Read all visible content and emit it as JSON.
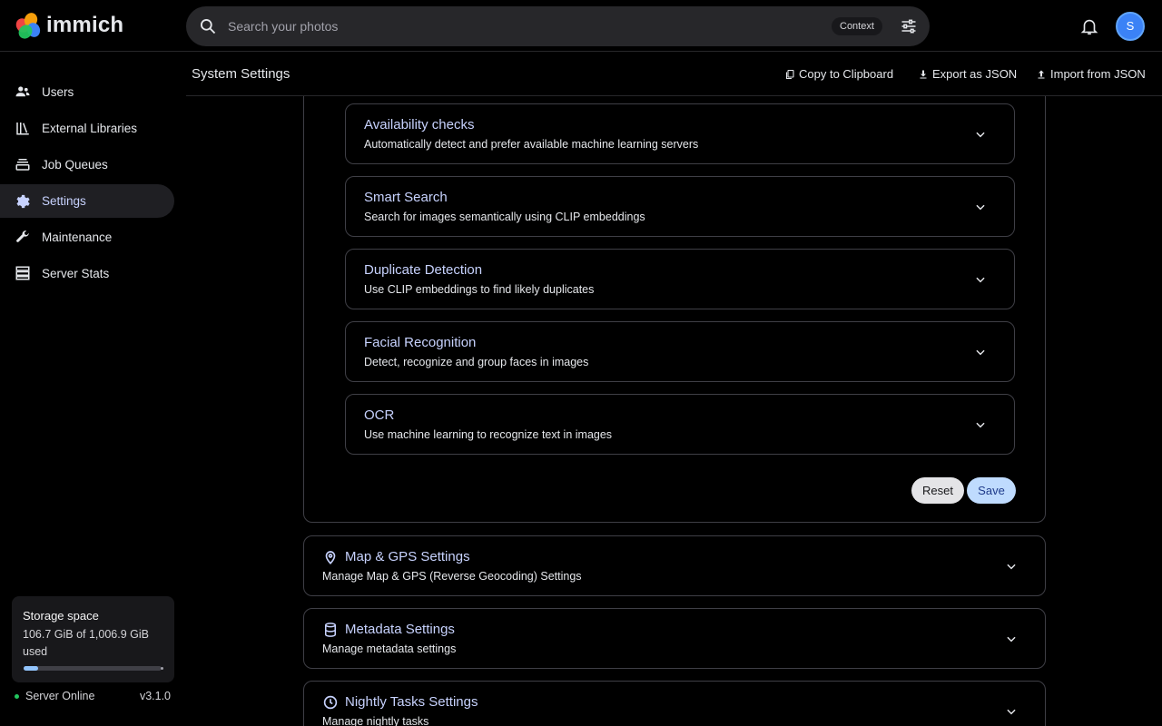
{
  "app": {
    "name": "immich"
  },
  "search": {
    "placeholder": "Search your photos",
    "context_label": "Context"
  },
  "user": {
    "initial": "S"
  },
  "sidebar": {
    "items": [
      {
        "label": "Users"
      },
      {
        "label": "External Libraries"
      },
      {
        "label": "Job Queues"
      },
      {
        "label": "Settings"
      },
      {
        "label": "Maintenance"
      },
      {
        "label": "Server Stats"
      }
    ],
    "active_index": 3,
    "storage": {
      "title": "Storage space",
      "detail": "106.7 GiB of 1,006.9 GiB used",
      "used_fraction": 0.106
    },
    "server": {
      "status": "Server Online",
      "version": "v3.1.0"
    }
  },
  "header": {
    "title": "System Settings",
    "copy_label": "Copy to Clipboard",
    "export_label": "Export as JSON",
    "import_label": "Import from JSON"
  },
  "ml_subsections": [
    {
      "title": "Availability checks",
      "description": "Automatically detect and prefer available machine learning servers"
    },
    {
      "title": "Smart Search",
      "description": "Search for images semantically using CLIP embeddings"
    },
    {
      "title": "Duplicate Detection",
      "description": "Use CLIP embeddings to find likely duplicates"
    },
    {
      "title": "Facial Recognition",
      "description": "Detect, recognize and group faces in images"
    },
    {
      "title": "OCR",
      "description": "Use machine learning to recognize text in images"
    }
  ],
  "actions": {
    "reset_label": "Reset",
    "save_label": "Save"
  },
  "sections": [
    {
      "title": "Map & GPS Settings",
      "description": "Manage Map & GPS (Reverse Geocoding) Settings",
      "icon": "map-pin-icon"
    },
    {
      "title": "Metadata Settings",
      "description": "Manage metadata settings",
      "icon": "database-icon"
    },
    {
      "title": "Nightly Tasks Settings",
      "description": "Manage nightly tasks",
      "icon": "clock-icon"
    }
  ],
  "colors": {
    "accent": "#c7d2fe",
    "avatar": "#3b82f6",
    "online": "#22c55e"
  }
}
